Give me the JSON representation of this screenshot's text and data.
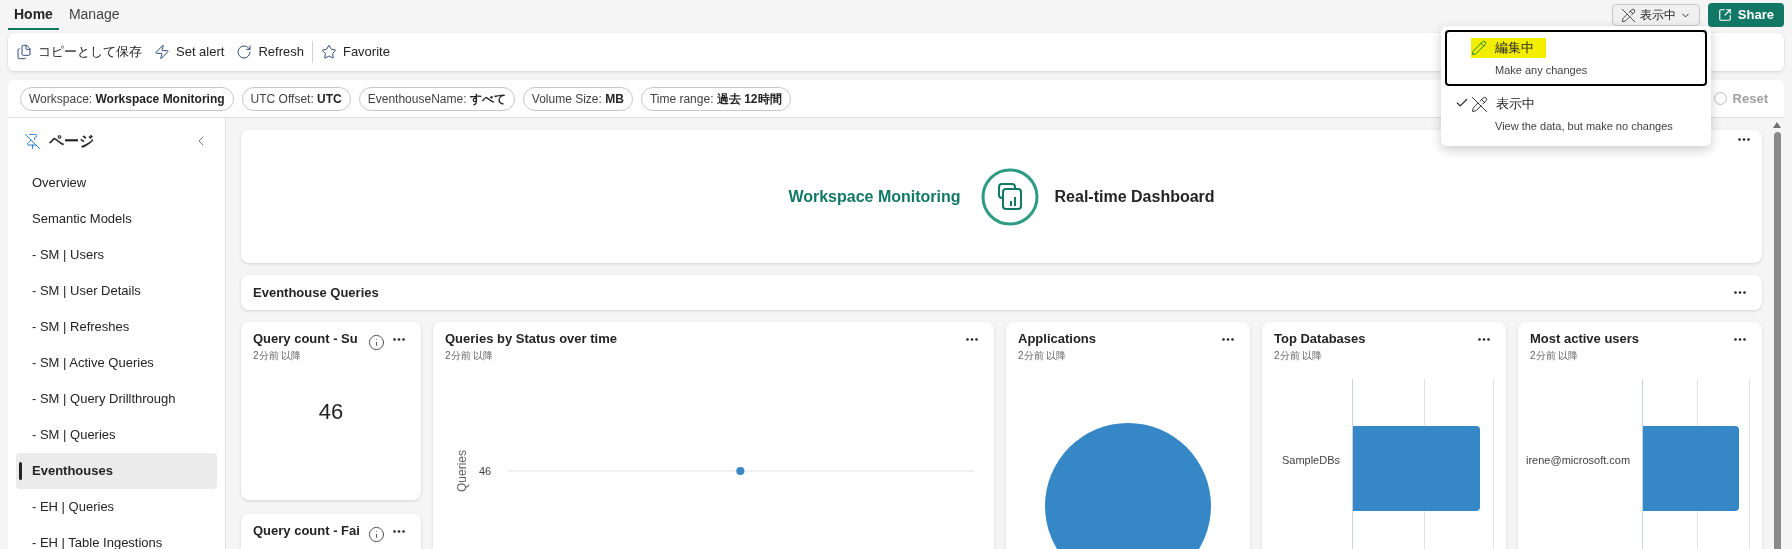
{
  "tabs": [
    {
      "label": "Home",
      "selected": true
    },
    {
      "label": "Manage",
      "selected": false
    }
  ],
  "mode_button": {
    "label": "表示中"
  },
  "share_button": {
    "label": "Share"
  },
  "mode_menu": [
    {
      "title": "編集中",
      "description": "Make any changes",
      "checked": false,
      "focused": true,
      "highlighted": true
    },
    {
      "title": "表示中",
      "description": "View the data, but make no changes",
      "checked": true,
      "focused": false,
      "highlighted": false
    }
  ],
  "toolbar": [
    {
      "kind": "copy",
      "label": "コピーとして保存"
    },
    {
      "kind": "alert",
      "label": "Set alert"
    },
    {
      "kind": "refresh",
      "label": "Refresh"
    },
    {
      "kind": "favorite",
      "label": "Favorite"
    }
  ],
  "filters": [
    {
      "name": "Workspace:",
      "value": "Workspace Monitoring"
    },
    {
      "name": "UTC Offset:",
      "value": "UTC"
    },
    {
      "name": "EventhouseName:",
      "value": "すべて"
    },
    {
      "name": "Volume Size:",
      "value": "MB"
    },
    {
      "name": "Time range:",
      "value": "過去 12時間"
    }
  ],
  "reset_button": {
    "label": "Reset"
  },
  "sidebar": {
    "title": "ページ",
    "items": [
      {
        "label": "Overview",
        "selected": false
      },
      {
        "label": "Semantic Models",
        "selected": false
      },
      {
        "label": "- SM | Users",
        "selected": false
      },
      {
        "label": "- SM | User Details",
        "selected": false
      },
      {
        "label": "- SM | Refreshes",
        "selected": false
      },
      {
        "label": "- SM | Active Queries",
        "selected": false
      },
      {
        "label": "- SM | Query Drillthrough",
        "selected": false
      },
      {
        "label": "- SM | Queries",
        "selected": false
      },
      {
        "label": "Eventhouses",
        "selected": true
      },
      {
        "label": "- EH | Queries",
        "selected": false
      },
      {
        "label": "- EH | Table Ingestions",
        "selected": false
      }
    ]
  },
  "banner": {
    "title": "Workspace Monitoring",
    "subtitle": "Real-time Dashboard"
  },
  "section": {
    "title": "Eventhouse Queries"
  },
  "stat_tiles": [
    {
      "title": "Query count - Su",
      "time": "2分前 以降",
      "value": "46"
    },
    {
      "title": "Query count - Fai"
    }
  ],
  "tiles": [
    {
      "kind": "line",
      "title": "Queries by Status over time",
      "time": "2分前 以降",
      "axis_label": "Queries",
      "tick": "46"
    },
    {
      "kind": "pie",
      "title": "Applications",
      "time": "2分前 以降"
    },
    {
      "kind": "bar",
      "title": "Top Databases",
      "time": "2分前 以降",
      "category": "SampleDBs"
    },
    {
      "kind": "bar",
      "title": "Most active users",
      "time": "2分前 以降",
      "category": "irene@microsoft.com"
    }
  ]
}
